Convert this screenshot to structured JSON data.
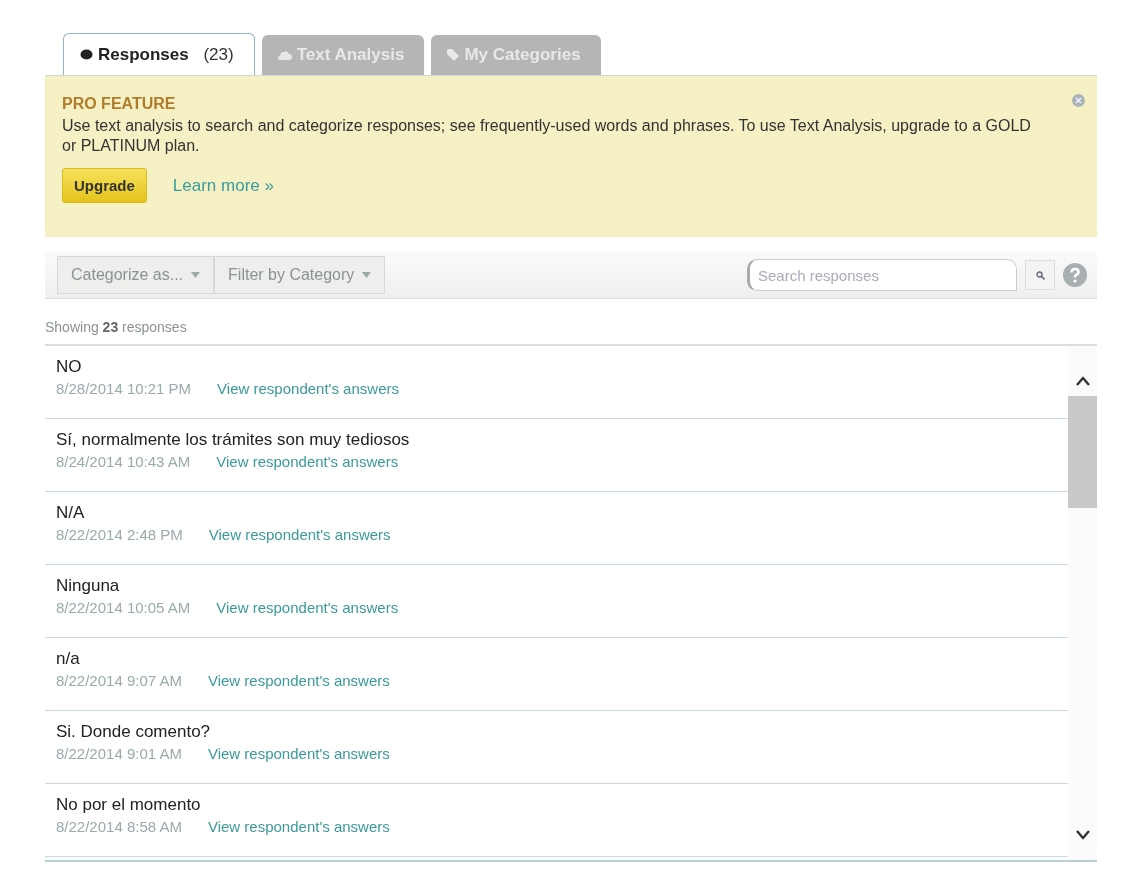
{
  "tabs": [
    {
      "label": "Responses",
      "count": "(23)",
      "selected": true
    },
    {
      "label": "Text Analysis",
      "selected": false
    },
    {
      "label": "My Categories",
      "selected": false
    }
  ],
  "banner": {
    "title": "PRO FEATURE",
    "message": "Use text analysis to search and categorize responses; see frequently-used words and phrases. To use Text Analysis, upgrade to a GOLD or PLATINUM plan.",
    "button": "Upgrade",
    "link": "Learn more »"
  },
  "toolbar": {
    "dropdowns": [
      "Categorize as...",
      "Filter by Category"
    ],
    "search": {
      "placeholder": "Search responses"
    }
  },
  "summary": "Showing **23** responses",
  "responses": [
    {
      "text": "NO",
      "date": "8/28/2014 10:21 PM",
      "link": "View respondent's answers"
    },
    {
      "text": "Sí, normalmente los trámites son muy tediosos",
      "date": "8/24/2014 10:43 AM",
      "link": "View respondent's answers"
    },
    {
      "text": "N/A",
      "date": "8/22/2014 2:48 PM",
      "link": "View respondent's answers"
    },
    {
      "text": "Ninguna",
      "date": "8/22/2014 10:05 AM",
      "link": "View respondent's answers"
    },
    {
      "text": "n/a",
      "date": "8/22/2014 9:07 AM",
      "link": "View respondent's answers"
    },
    {
      "text": "Si. Donde comento?",
      "date": "8/22/2014 9:01 AM",
      "link": "View respondent's answers"
    },
    {
      "text": "No por el momento",
      "date": "8/22/2014 8:58 AM",
      "link": "View respondent's answers"
    }
  ]
}
